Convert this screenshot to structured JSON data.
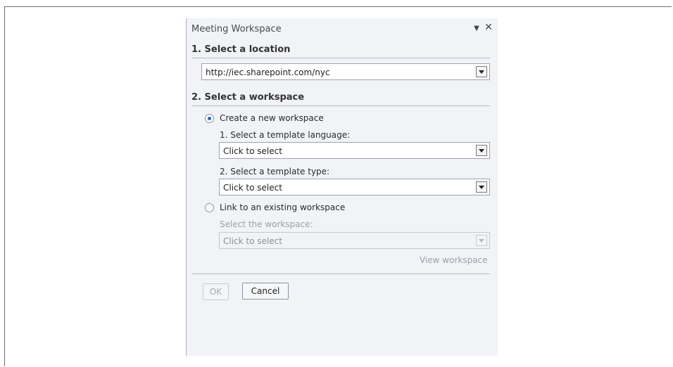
{
  "pane": {
    "title": "Meeting Workspace",
    "menu_glyph": "▼",
    "close_glyph": "✕"
  },
  "location": {
    "heading": "1. Select a location",
    "value": "http://iec.sharepoint.com/nyc"
  },
  "workspace": {
    "heading": "2. Select a workspace",
    "create": {
      "label": "Create a new workspace",
      "selected": true,
      "language_label": "1. Select a template language:",
      "language_value": "Click to select",
      "type_label": "2. Select a template type:",
      "type_value": "Click to select"
    },
    "link": {
      "label": "Link to an existing workspace",
      "selected": false,
      "select_label": "Select the workspace:",
      "select_value": "Click to select",
      "view_link": "View workspace"
    }
  },
  "buttons": {
    "ok": "OK",
    "cancel": "Cancel"
  }
}
